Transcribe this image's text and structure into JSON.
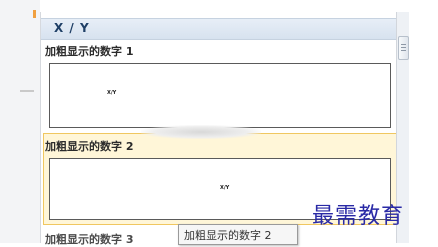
{
  "panel": {
    "header_title": "X / Y"
  },
  "items": [
    {
      "label": "加粗显示的数字 1",
      "sample_text": "X/Y"
    },
    {
      "label": "加粗显示的数字 2",
      "sample_text": "X/Y",
      "selected": true
    },
    {
      "label": "加粗显示的数字 3"
    }
  ],
  "tooltip": {
    "text": "加粗显示的数字 2"
  },
  "watermark": {
    "text": "最需教育"
  },
  "colors": {
    "header_bg": "#dbe5f1",
    "selected_bg": "#fff6d8",
    "selected_border": "#f0c760",
    "watermark": "#2a2aa6"
  }
}
